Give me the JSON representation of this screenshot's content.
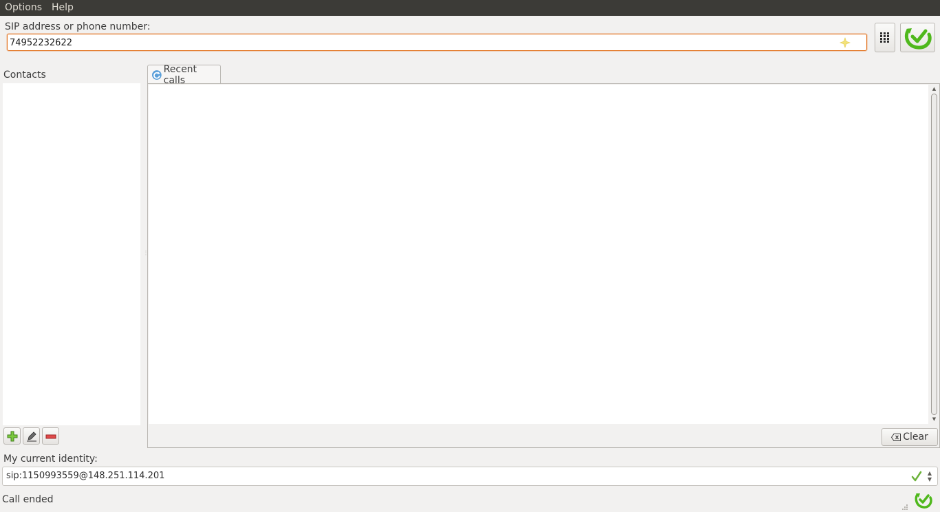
{
  "menubar": {
    "items": [
      "Options",
      "Help"
    ]
  },
  "sip": {
    "label": "SIP address or phone number:",
    "value": "74952232622",
    "star_icon": "favorite-star-icon"
  },
  "toolbar": {
    "dialpad_icon": "dialpad-grid-icon",
    "call_icon": "call-green-arrow-icon"
  },
  "contacts": {
    "label": "Contacts",
    "buttons": [
      "add-contact",
      "edit-contact",
      "remove-contact"
    ]
  },
  "tabs": [
    {
      "label": "Recent calls",
      "icon": "refresh-icon"
    }
  ],
  "recent_calls": {
    "clear_label": "Clear",
    "clear_icon": "backspace-icon"
  },
  "identity": {
    "label": "My current identity:",
    "value": "sip:1150993559@148.251.114.201",
    "status_icon": "checkmark-icon"
  },
  "status": {
    "text": "Call ended",
    "icon": "linphone-logo-icon"
  },
  "colors": {
    "menubar_bg": "#3c3b37",
    "focus_border": "#e2711d",
    "accent_green": "#4fb81c"
  }
}
